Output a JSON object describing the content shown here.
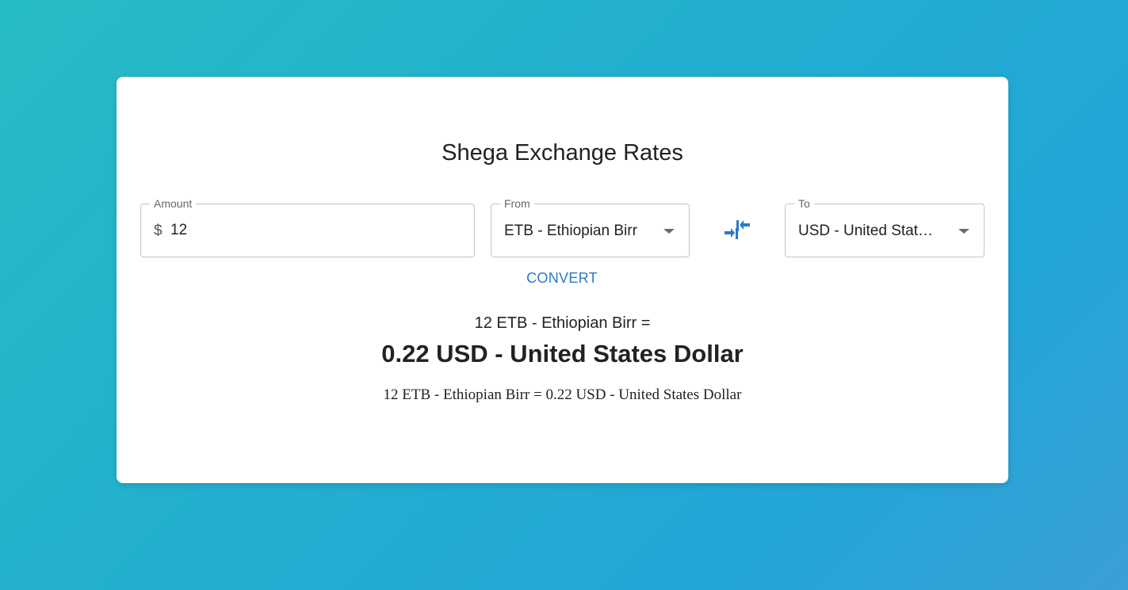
{
  "app": {
    "title": "Shega Exchange Rates"
  },
  "form": {
    "amount": {
      "label": "Amount",
      "prefix": "$",
      "value": "12"
    },
    "from": {
      "label": "From",
      "selected": "ETB - Ethiopian Birr"
    },
    "swap": {
      "icon": "compare-arrows-icon"
    },
    "to": {
      "label": "To",
      "selected": "USD - United States Dollar"
    },
    "convert_label": "CONVERT"
  },
  "result": {
    "from_text": "12 ETB - Ethiopian Birr =",
    "to_text": "0.22 USD - United States Dollar",
    "summary": "12 ETB - Ethiopian Birr = 0.22 USD - United States Dollar"
  },
  "colors": {
    "accent": "#2b79c9",
    "background_start": "#26bcc4",
    "background_end": "#3a9fd6",
    "card": "#ffffff"
  }
}
